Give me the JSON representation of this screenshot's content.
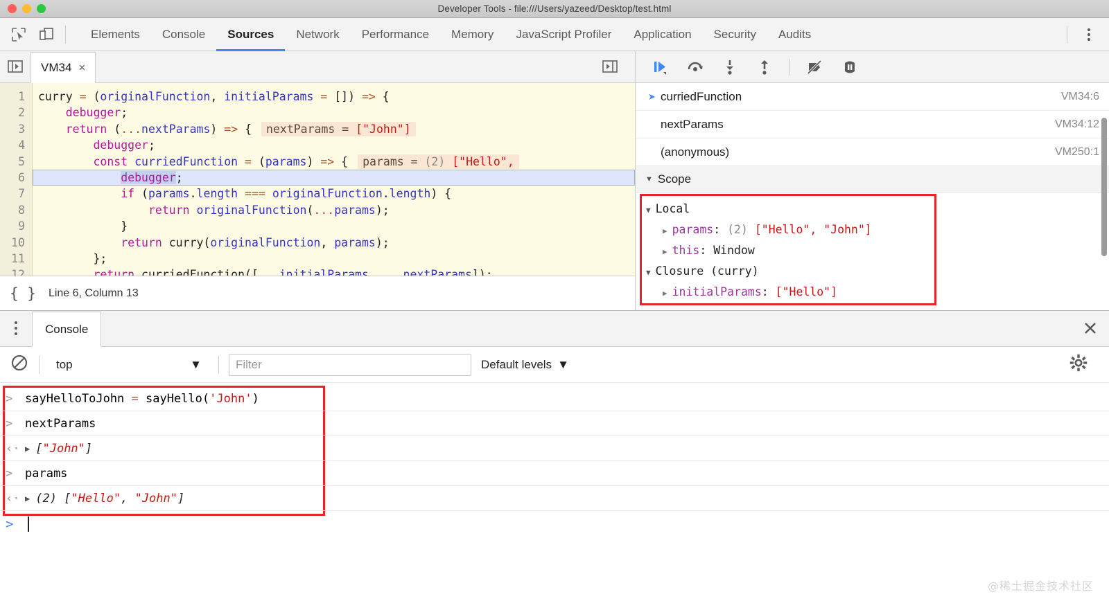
{
  "window": {
    "title": "Developer Tools - file:///Users/yazeed/Desktop/test.html",
    "traffic_lights": [
      "close",
      "minimize",
      "zoom"
    ]
  },
  "toolbar": {
    "inspect_icon": "inspect-element-icon",
    "device_icon": "device-toolbar-icon",
    "more_icon": "more-options-kebab-icon"
  },
  "main_tabs": [
    {
      "label": "Elements",
      "active": false
    },
    {
      "label": "Console",
      "active": false
    },
    {
      "label": "Sources",
      "active": true
    },
    {
      "label": "Network",
      "active": false
    },
    {
      "label": "Performance",
      "active": false
    },
    {
      "label": "Memory",
      "active": false
    },
    {
      "label": "JavaScript Profiler",
      "active": false
    },
    {
      "label": "Application",
      "active": false
    },
    {
      "label": "Security",
      "active": false
    },
    {
      "label": "Audits",
      "active": false
    }
  ],
  "sources": {
    "navigator_toggle_icon": "show-navigator-icon",
    "file_tab": {
      "label": "VM34",
      "close_label": "×"
    },
    "editor_toggle_icon": "show-debugger-icon",
    "current_line": 6,
    "status": {
      "format_icon": "pretty-print-braces",
      "position": "Line 6, Column 13"
    },
    "code_lines": [
      {
        "num": "1",
        "indent": 0,
        "tokens": [
          {
            "t": "plain",
            "v": "curry "
          },
          {
            "t": "op",
            "v": "= "
          },
          {
            "t": "plain",
            "v": "("
          },
          {
            "t": "var",
            "v": "originalFunction"
          },
          {
            "t": "plain",
            "v": ", "
          },
          {
            "t": "var",
            "v": "initialParams "
          },
          {
            "t": "op",
            "v": "= "
          },
          {
            "t": "plain",
            "v": "[]) "
          },
          {
            "t": "op",
            "v": "=>"
          },
          {
            "t": "plain",
            "v": " {"
          }
        ],
        "hint": null
      },
      {
        "num": "2",
        "indent": 1,
        "tokens": [
          {
            "t": "kw",
            "v": "debugger"
          },
          {
            "t": "plain",
            "v": ";"
          }
        ],
        "hint": null
      },
      {
        "num": "3",
        "indent": 1,
        "tokens": [
          {
            "t": "kw",
            "v": "return "
          },
          {
            "t": "plain",
            "v": "("
          },
          {
            "t": "op",
            "v": "..."
          },
          {
            "t": "var",
            "v": "nextParams"
          },
          {
            "t": "plain",
            "v": ") "
          },
          {
            "t": "op",
            "v": "=>"
          },
          {
            "t": "plain",
            "v": " {"
          }
        ],
        "hint": {
          "name": "nextParams",
          "count": null,
          "value": "[\"John\"]"
        }
      },
      {
        "num": "4",
        "indent": 2,
        "tokens": [
          {
            "t": "kw",
            "v": "debugger"
          },
          {
            "t": "plain",
            "v": ";"
          }
        ],
        "hint": null
      },
      {
        "num": "5",
        "indent": 2,
        "tokens": [
          {
            "t": "kw",
            "v": "const "
          },
          {
            "t": "var",
            "v": "curriedFunction "
          },
          {
            "t": "op",
            "v": "= "
          },
          {
            "t": "plain",
            "v": "("
          },
          {
            "t": "var",
            "v": "params"
          },
          {
            "t": "plain",
            "v": ") "
          },
          {
            "t": "op",
            "v": "=>"
          },
          {
            "t": "plain",
            "v": " {"
          }
        ],
        "hint": {
          "name": "params",
          "count": "(2)",
          "value": "[\"Hello\","
        }
      },
      {
        "num": "6",
        "indent": 3,
        "current": true,
        "selected": true,
        "tokens": [
          {
            "t": "kw",
            "v": "debugger"
          },
          {
            "t": "plain",
            "v": ";"
          }
        ],
        "hint": null
      },
      {
        "num": "7",
        "indent": 3,
        "tokens": [
          {
            "t": "kw",
            "v": "if "
          },
          {
            "t": "plain",
            "v": "("
          },
          {
            "t": "var",
            "v": "params"
          },
          {
            "t": "plain",
            "v": "."
          },
          {
            "t": "var",
            "v": "length "
          },
          {
            "t": "op",
            "v": "=== "
          },
          {
            "t": "var",
            "v": "originalFunction"
          },
          {
            "t": "plain",
            "v": "."
          },
          {
            "t": "var",
            "v": "length"
          },
          {
            "t": "plain",
            "v": ") {"
          }
        ],
        "hint": null
      },
      {
        "num": "8",
        "indent": 4,
        "tokens": [
          {
            "t": "kw",
            "v": "return "
          },
          {
            "t": "var",
            "v": "originalFunction"
          },
          {
            "t": "plain",
            "v": "("
          },
          {
            "t": "op",
            "v": "..."
          },
          {
            "t": "var",
            "v": "params"
          },
          {
            "t": "plain",
            "v": ");"
          }
        ],
        "hint": null
      },
      {
        "num": "9",
        "indent": 3,
        "tokens": [
          {
            "t": "plain",
            "v": "}"
          }
        ],
        "hint": null
      },
      {
        "num": "10",
        "indent": 3,
        "tokens": [
          {
            "t": "kw",
            "v": "return "
          },
          {
            "t": "plain",
            "v": "curry("
          },
          {
            "t": "var",
            "v": "originalFunction"
          },
          {
            "t": "plain",
            "v": ", "
          },
          {
            "t": "var",
            "v": "params"
          },
          {
            "t": "plain",
            "v": ");"
          }
        ],
        "hint": null
      },
      {
        "num": "11",
        "indent": 2,
        "tokens": [
          {
            "t": "plain",
            "v": "};"
          }
        ],
        "hint": null
      },
      {
        "num": "12",
        "indent": 2,
        "clipped": true,
        "tokens": [
          {
            "t": "kw",
            "v": "return "
          },
          {
            "t": "plain",
            "v": "curriedFunction(["
          },
          {
            "t": "op",
            "v": "..."
          },
          {
            "t": "var",
            "v": "initialParams"
          },
          {
            "t": "plain",
            "v": ", "
          },
          {
            "t": "op",
            "v": "..."
          },
          {
            "t": "var",
            "v": "nextParams"
          },
          {
            "t": "plain",
            "v": "]);"
          }
        ],
        "hint": null
      }
    ]
  },
  "debugger": {
    "buttons": [
      {
        "name": "resume-script-execution",
        "icon": "resume-icon"
      },
      {
        "name": "step-over-next-function-call",
        "icon": "step-over-icon"
      },
      {
        "name": "step-into-next-function-call",
        "icon": "step-into-icon"
      },
      {
        "name": "step-out-of-current-function",
        "icon": "step-out-icon"
      },
      {
        "name": "deactivate-breakpoints",
        "icon": "deactivate-breakpoints-icon"
      },
      {
        "name": "pause-on-exceptions",
        "icon": "pause-on-exceptions-icon"
      }
    ],
    "call_stack": [
      {
        "name": "curriedFunction",
        "location": "VM34:6",
        "active": true
      },
      {
        "name": "nextParams",
        "location": "VM34:12",
        "active": false
      },
      {
        "name": "(anonymous)",
        "location": "VM250:1",
        "active": false
      }
    ],
    "scope_header": "Scope",
    "scope": [
      {
        "kind": "group",
        "expanded": true,
        "label": "Local"
      },
      {
        "kind": "prop",
        "name": "params",
        "count": "(2)",
        "value": "[\"Hello\", \"John\"]"
      },
      {
        "kind": "prop",
        "name": "this",
        "count": null,
        "value": "Window",
        "plain_value": true
      },
      {
        "kind": "group",
        "expanded": true,
        "label": "Closure (curry)"
      },
      {
        "kind": "prop",
        "name": "initialParams",
        "count": null,
        "value": "[\"Hello\"]"
      }
    ],
    "highlight_color": "#e8232a"
  },
  "drawer": {
    "kebab_icon": "more-tools-kebab-icon",
    "tab_label": "Console",
    "close_icon": "close-drawer-icon",
    "clear_icon": "clear-console-icon",
    "context": "top",
    "context_caret": "▼",
    "filter_placeholder": "Filter",
    "levels_label": "Default levels",
    "levels_caret": "▼",
    "settings_icon": "console-settings-gear-icon",
    "highlight_color": "#e8232a",
    "messages": [
      {
        "type": "input",
        "glyph": ">",
        "parts": [
          {
            "t": "plain",
            "v": "sayHelloToJohn "
          },
          {
            "t": "op",
            "v": "= "
          },
          {
            "t": "plain",
            "v": "sayHello("
          },
          {
            "t": "str",
            "v": "'John'"
          },
          {
            "t": "plain",
            "v": ")"
          }
        ]
      },
      {
        "type": "input",
        "glyph": ">",
        "parts": [
          {
            "t": "plain",
            "v": "nextParams"
          }
        ]
      },
      {
        "type": "output",
        "glyph": "‹·",
        "expandable": true,
        "count": null,
        "parts": [
          {
            "t": "val",
            "v": "["
          },
          {
            "t": "str",
            "v": "\"John\""
          },
          {
            "t": "val",
            "v": "]"
          }
        ]
      },
      {
        "type": "input",
        "glyph": ">",
        "parts": [
          {
            "t": "plain",
            "v": "params"
          }
        ]
      },
      {
        "type": "output",
        "glyph": "‹·",
        "expandable": true,
        "count": "(2)",
        "parts": [
          {
            "t": "val",
            "v": "["
          },
          {
            "t": "str",
            "v": "\"Hello\""
          },
          {
            "t": "val",
            "v": ", "
          },
          {
            "t": "str",
            "v": "\"John\""
          },
          {
            "t": "val",
            "v": "]"
          }
        ]
      }
    ],
    "prompt_glyph": ">"
  },
  "watermark": "@稀土掘金技术社区"
}
